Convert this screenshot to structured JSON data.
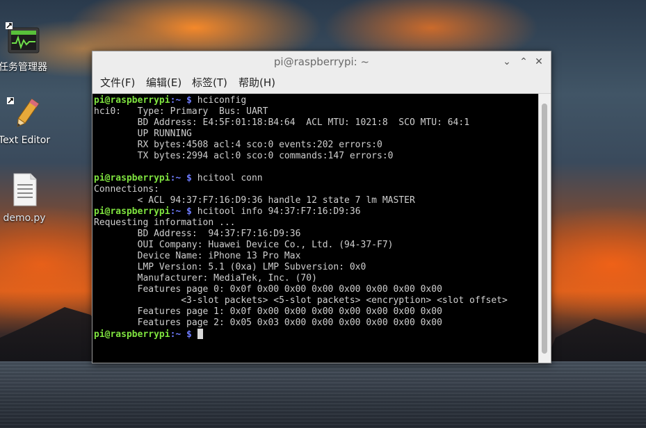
{
  "desktop": {
    "icons": [
      {
        "label": "任务管理器",
        "icon": "task-manager-icon"
      },
      {
        "label": "Text Editor",
        "icon": "text-editor-icon"
      },
      {
        "label": "demo.py",
        "icon": "python-file-icon"
      }
    ]
  },
  "window": {
    "title": "pi@raspberrypi: ~",
    "buttons": {
      "minimize": "⌄",
      "maximize": "⌃",
      "close": "✕"
    },
    "menu": [
      "文件(F)",
      "编辑(E)",
      "标签(T)",
      "帮助(H)"
    ]
  },
  "terminal": {
    "prompt_user": "pi@raspberrypi",
    "prompt_path": ":~",
    "prompt_symbol": " $ ",
    "lines": [
      {
        "type": "prompt",
        "command": "hciconfig"
      },
      {
        "type": "out",
        "text": "hci0:   Type: Primary  Bus: UART"
      },
      {
        "type": "out",
        "text": "        BD Address: E4:5F:01:18:B4:64  ACL MTU: 1021:8  SCO MTU: 64:1"
      },
      {
        "type": "out",
        "text": "        UP RUNNING"
      },
      {
        "type": "out",
        "text": "        RX bytes:4508 acl:4 sco:0 events:202 errors:0"
      },
      {
        "type": "out",
        "text": "        TX bytes:2994 acl:0 sco:0 commands:147 errors:0"
      },
      {
        "type": "out",
        "text": ""
      },
      {
        "type": "prompt",
        "command": "hcitool conn"
      },
      {
        "type": "out",
        "text": "Connections:"
      },
      {
        "type": "out",
        "text": "        < ACL 94:37:F7:16:D9:36 handle 12 state 7 lm MASTER"
      },
      {
        "type": "prompt",
        "command": "hcitool info 94:37:F7:16:D9:36"
      },
      {
        "type": "out",
        "text": "Requesting information ..."
      },
      {
        "type": "out",
        "text": "        BD Address:  94:37:F7:16:D9:36"
      },
      {
        "type": "out",
        "text": "        OUI Company: Huawei Device Co., Ltd. (94-37-F7)"
      },
      {
        "type": "out",
        "text": "        Device Name: iPhone 13 Pro Max"
      },
      {
        "type": "out",
        "text": "        LMP Version: 5.1 (0xa) LMP Subversion: 0x0"
      },
      {
        "type": "out",
        "text": "        Manufacturer: MediaTek, Inc. (70)"
      },
      {
        "type": "out",
        "text": "        Features page 0: 0x0f 0x00 0x00 0x00 0x00 0x00 0x00 0x00"
      },
      {
        "type": "out",
        "text": "                <3-slot packets> <5-slot packets> <encryption> <slot offset>"
      },
      {
        "type": "out",
        "text": "        Features page 1: 0x0f 0x00 0x00 0x00 0x00 0x00 0x00 0x00"
      },
      {
        "type": "out",
        "text": "        Features page 2: 0x05 0x03 0x00 0x00 0x00 0x00 0x00 0x00"
      },
      {
        "type": "prompt",
        "command": "",
        "cursor": true
      }
    ]
  }
}
